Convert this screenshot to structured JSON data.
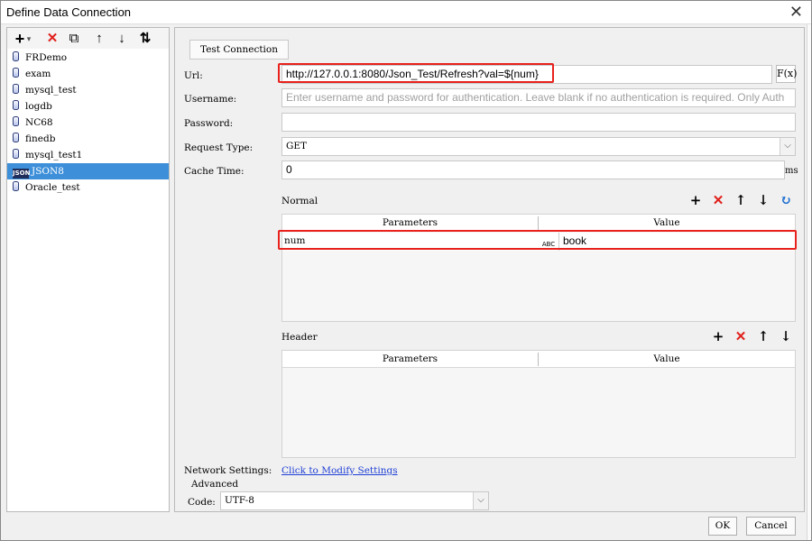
{
  "window": {
    "title": "Define Data Connection",
    "close_glyph": "✕"
  },
  "left_toolbar": {
    "add_glyph": "+",
    "dropdown_glyph": "▾",
    "delete_glyph": "✕",
    "copy_glyph": "⧉",
    "up_glyph": "↑",
    "down_glyph": "↓",
    "sort_glyph": "⇅"
  },
  "connections": [
    {
      "name": "FRDemo",
      "type": "db"
    },
    {
      "name": "exam",
      "type": "db"
    },
    {
      "name": "mysql_test",
      "type": "db"
    },
    {
      "name": "logdb",
      "type": "db"
    },
    {
      "name": "NC68",
      "type": "db"
    },
    {
      "name": "finedb",
      "type": "db"
    },
    {
      "name": "mysql_test1",
      "type": "db"
    },
    {
      "name": "JSON8",
      "type": "json",
      "selected": true,
      "icon_text": "JSON"
    },
    {
      "name": "Oracle_test",
      "type": "db"
    }
  ],
  "form": {
    "test_connection": "Test Connection",
    "url_label": "Url:",
    "url_value": "http://127.0.0.1:8080/Json_Test/Refresh?val=${num}",
    "fx_label": "F(x)",
    "username_label": "Username:",
    "username_placeholder": "Enter username and password for authentication. Leave blank if no authentication is required. Only Auth",
    "password_label": "Password:",
    "request_type_label": "Request Type:",
    "request_type_value": "GET",
    "cache_time_label": "Cache Time:",
    "cache_time_value": "0",
    "cache_time_unit": "ms"
  },
  "normal": {
    "label": "Normal",
    "col_parameters": "Parameters",
    "col_value": "Value",
    "rows": [
      {
        "param": "num",
        "type_label": "ABC",
        "value": "book"
      }
    ]
  },
  "header": {
    "label": "Header",
    "col_parameters": "Parameters",
    "col_value": "Value"
  },
  "tools": {
    "add": "+",
    "delete": "✕",
    "up": "↑",
    "down": "↓",
    "refresh": "↻"
  },
  "network": {
    "label": "Network Settings:",
    "link": "Click to Modify Settings"
  },
  "advanced": {
    "label": "Advanced",
    "code_label": "Code:",
    "code_value": "UTF-8",
    "arrow": "⌵"
  },
  "buttons": {
    "ok": "OK",
    "cancel": "Cancel"
  },
  "colors": {
    "selection": "#3d8fd9",
    "highlight_border": "#e8211c",
    "delete_red": "#e0201b",
    "refresh_blue": "#1f6fd0",
    "link": "#1f3fd6"
  }
}
